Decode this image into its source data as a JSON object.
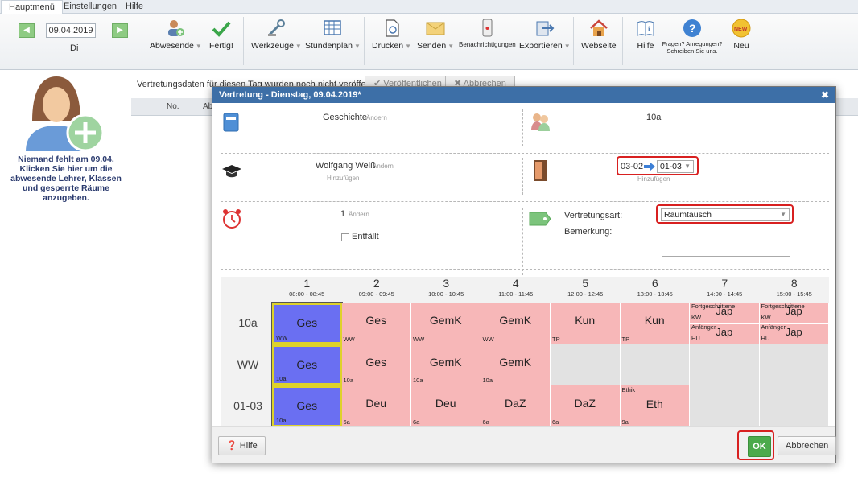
{
  "menu": {
    "tabs": [
      "Hauptmenü",
      "Einstellungen",
      "Hilfe"
    ]
  },
  "ribbon": {
    "date": "09.04.2019",
    "day": "Di",
    "buttons": {
      "abwesende": "Abwesende",
      "fertig": "Fertig!",
      "werkzeuge": "Werkzeuge",
      "stundenplan": "Stundenplan",
      "drucken": "Drucken",
      "senden": "Senden",
      "benachrichtigungen": "Benachrichtigungen",
      "exportieren": "Exportieren",
      "webseite": "Webseite",
      "hilfe": "Hilfe",
      "fragen": "Fragen? Anregungen? Schreiben Sie uns.",
      "neu": "Neu",
      "neu_badge": "NEW"
    }
  },
  "left": {
    "message": "Niemand fehlt am 09.04. Klicken Sie hier um die abwesende Lehrer, Klassen und gesperrte Räume anzugeben."
  },
  "main": {
    "notice": "Vertretungsdaten für diesen Tag wurden noch nicht veröffentlicht.",
    "publish": "✔ Veröffentlichen",
    "cancel": "✖ Abbrechen",
    "col_no": "No.",
    "col_ab": "Ab"
  },
  "dialog": {
    "title": "Vertretung - Dienstag, 09.04.2019*",
    "subject": "Geschichte",
    "change": "Ändern",
    "add": "Hinzufügen",
    "class": "10a",
    "teacher": "Wolfgang Weiß",
    "room_from": "03-02",
    "room_to": "01-03",
    "period": "1",
    "cancelled_label": "Entfällt",
    "type_label": "Vertretungsart:",
    "type_value": "Raumtausch",
    "remark_label": "Bemerkung:",
    "help_button": "Hilfe",
    "ok_button": "OK",
    "cancel_button": "Abbrechen"
  },
  "timetable": {
    "periods": [
      {
        "num": "1",
        "time": "08:00 - 08:45"
      },
      {
        "num": "2",
        "time": "09:00 - 09:45"
      },
      {
        "num": "3",
        "time": "10:00 - 10:45"
      },
      {
        "num": "4",
        "time": "11:00 - 11:45"
      },
      {
        "num": "5",
        "time": "12:00 - 12:45"
      },
      {
        "num": "6",
        "time": "13:00 - 13:45"
      },
      {
        "num": "7",
        "time": "14:00 - 14:45"
      },
      {
        "num": "8",
        "time": "15:00 - 15:45"
      }
    ],
    "rows": [
      {
        "label": "10a",
        "cells": [
          {
            "subj": "Ges",
            "sub": "WW"
          },
          {
            "subj": "Ges",
            "sub": "WW"
          },
          {
            "subj": "GemK",
            "sub": "WW"
          },
          {
            "subj": "GemK",
            "sub": "WW"
          },
          {
            "subj": "Kun",
            "sub": "TP"
          },
          {
            "subj": "Kun",
            "sub": "TP"
          }
        ]
      },
      {
        "label": "WW",
        "cells": [
          {
            "subj": "Ges",
            "sub": "10a"
          },
          {
            "subj": "Ges",
            "sub": "10a"
          },
          {
            "subj": "GemK",
            "sub": "10a"
          },
          {
            "subj": "GemK",
            "sub": "10a"
          }
        ]
      },
      {
        "label": "01-03",
        "cells": [
          {
            "subj": "Ges",
            "sub": "10a"
          },
          {
            "subj": "Deu",
            "sub": "6a"
          },
          {
            "subj": "Deu",
            "sub": "6a"
          },
          {
            "subj": "DaZ",
            "sub": "6a"
          },
          {
            "subj": "DaZ",
            "sub": "6a"
          },
          {
            "subj": "Eth",
            "sub": "9a",
            "top": "Ethik"
          }
        ]
      }
    ],
    "split": {
      "top_group": "Fortgeschrittene",
      "top_subj": "Jap",
      "top_sub": "KW",
      "bottom_group": "Anfänger",
      "bottom_subj": "Jap",
      "bottom_sub": "HU"
    }
  }
}
